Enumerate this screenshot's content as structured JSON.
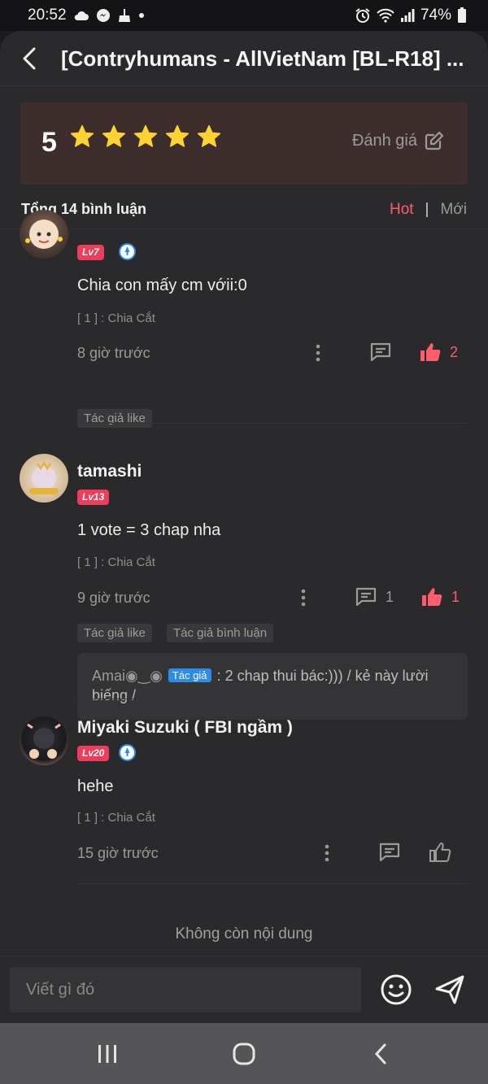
{
  "status_bar": {
    "time": "20:52",
    "battery": "74%"
  },
  "header": {
    "title": "[Contryhumans - AllVietNam [BL-R18] ..."
  },
  "rating": {
    "score": "5",
    "stars": 5,
    "rate_label": "Đánh giá"
  },
  "comments_bar": {
    "total": "Tổng 14 bình luận",
    "sort_hot": "Hot",
    "sort_separator": "|",
    "sort_new": "Mới"
  },
  "comments": [
    {
      "username": "",
      "level": "Lv7",
      "text": "Chia con mấy cm vớii:0",
      "chapter": "[ 1 ] : Chia Cắt",
      "time": "8 giờ trước",
      "reply_count": "",
      "like_count": "2",
      "tags": [
        "Tác giả like"
      ]
    },
    {
      "username": "tamashi",
      "level": "Lv13",
      "text": "1 vote = 3 chap nha",
      "chapter": "[ 1 ] : Chia Cắt",
      "time": "9 giờ trước",
      "reply_count": "1",
      "like_count": "1",
      "tags": [
        "Tác giả like",
        "Tác giả bình luận"
      ],
      "reply": {
        "author": "Amai◉‿◉",
        "author_tag": "Tác giả",
        "text": ": 2 chap thui bác:))) / kẻ này lười biếng /"
      }
    },
    {
      "username": "Miyaki Suzuki ( FBI ngầm )",
      "level": "Lv20",
      "text": "hehe",
      "chapter": "[ 1 ] : Chia Cắt",
      "time": "15 giờ trước",
      "reply_count": "",
      "like_count": "",
      "tags": []
    }
  ],
  "end_text": "Không còn nội dung",
  "input": {
    "placeholder": "Viết gì đó"
  },
  "colors": {
    "accent": "#ff5c6c",
    "star": "#ffd233",
    "level_badge": "#ef3c5a",
    "author_tag": "#2b8de8",
    "rating_card": "#3e2d2d"
  }
}
